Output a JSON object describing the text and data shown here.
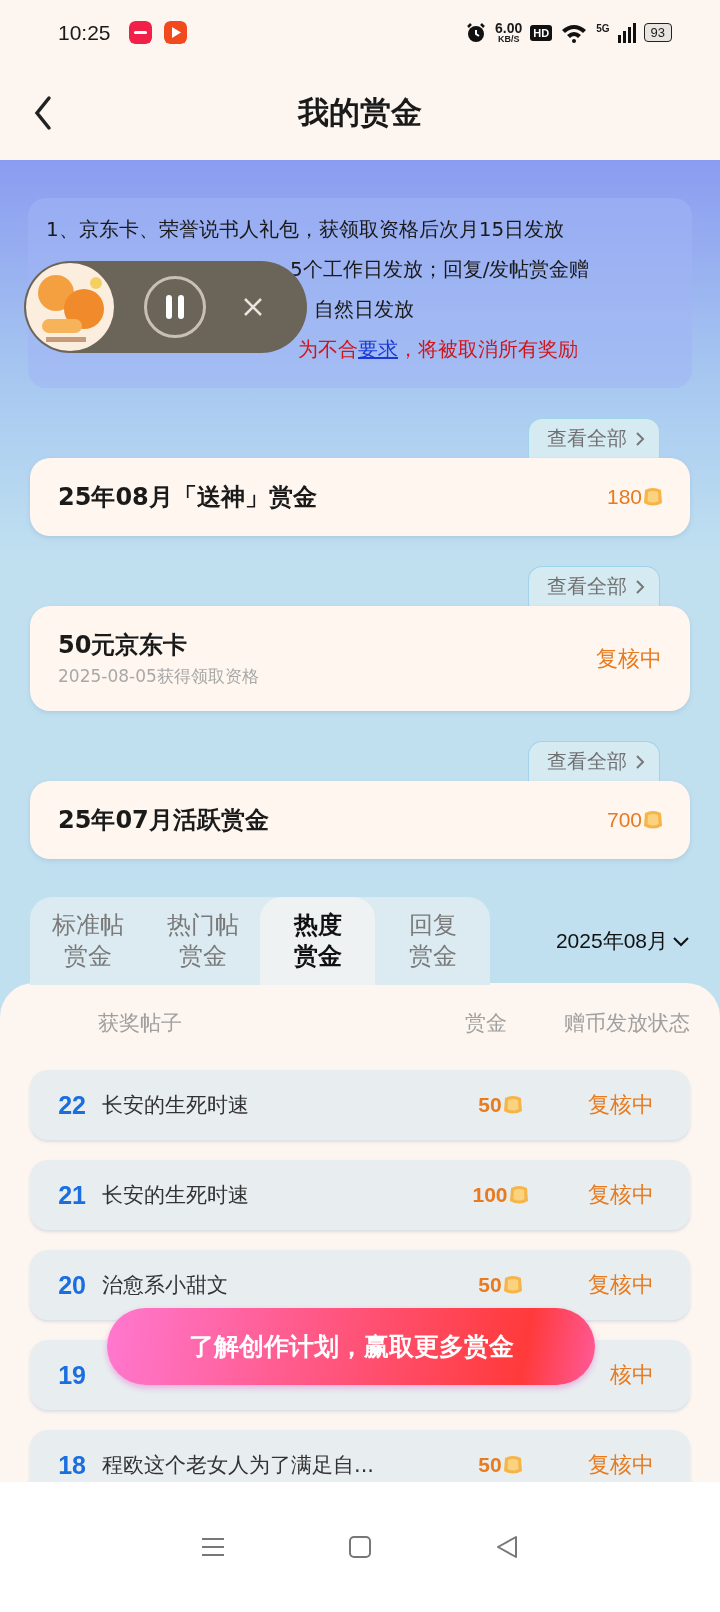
{
  "status_bar": {
    "time": "10:25",
    "net_speed": "6.00",
    "net_unit": "KB/S",
    "hd": "HD",
    "network": "5G",
    "battery": "93"
  },
  "header": {
    "title": "我的赏金"
  },
  "notice": {
    "lines": [
      {
        "kind": "plain",
        "text": "1、京东卡、荣誉说书人礼包，获领取资格后次月15日发放"
      },
      {
        "kind": "partial",
        "text": "5个工作日发放；回复/发帖赏金赠"
      },
      {
        "kind": "partial",
        "text": "自然日发放"
      },
      {
        "kind": "warning",
        "text": "为不合",
        "link": "要求",
        "after": "，将被取消所有奖励"
      }
    ]
  },
  "rewards": [
    {
      "link": "查看全部",
      "title": "25年08月「送神」赏金",
      "amount": "180"
    },
    {
      "link": "查看全部",
      "title": "50元京东卡",
      "subtitle": "2025-08-05获得领取资格",
      "status": "复核中"
    },
    {
      "link": "查看全部",
      "title": "25年07月活跃赏金",
      "amount": "700"
    }
  ],
  "tabs": [
    {
      "label": "标准帖赏金",
      "selected": false
    },
    {
      "label": "热门帖赏金",
      "selected": false
    },
    {
      "label": "热度赏金",
      "selected": true
    },
    {
      "label": "回复赏金",
      "selected": false
    }
  ],
  "month_picker": "2025年08月",
  "table": {
    "columns": [
      "获奖帖子",
      "赏金",
      "赠币发放状态"
    ],
    "rows": [
      {
        "rank": "22",
        "title": "长安的生死时速",
        "amount": "50",
        "status": "复核中"
      },
      {
        "rank": "21",
        "title": "长安的生死时速",
        "amount": "100",
        "status": "复核中"
      },
      {
        "rank": "20",
        "title": "治愈系小甜文",
        "amount": "50",
        "status": "复核中"
      },
      {
        "rank": "19",
        "status": "核中"
      },
      {
        "rank": "18",
        "title": "程欧这个老女人为了满足自...",
        "amount": "50",
        "status": "复核中"
      }
    ]
  },
  "cta_button": "了解创作计划，赢取更多赏金"
}
